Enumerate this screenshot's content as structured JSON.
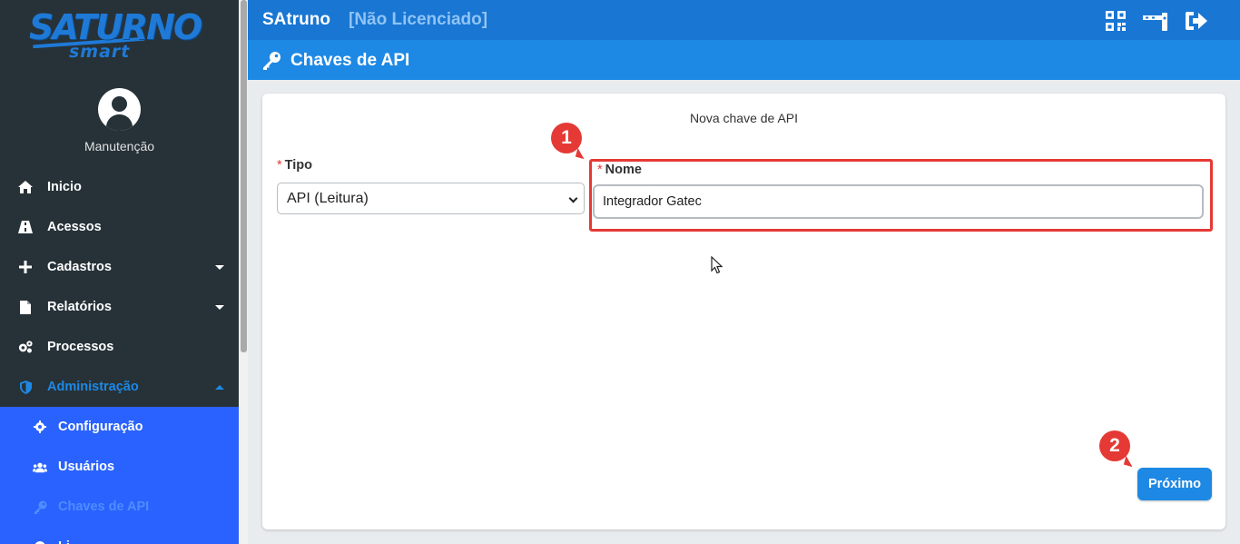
{
  "logo": {
    "line1": "SATURNO",
    "line2": "smart"
  },
  "user": {
    "name": "Manutenção"
  },
  "sidebar": {
    "items": [
      {
        "label": "Inicio",
        "icon": "home-icon"
      },
      {
        "label": "Acessos",
        "icon": "road-icon"
      },
      {
        "label": "Cadastros",
        "icon": "plus-icon"
      },
      {
        "label": "Relatórios",
        "icon": "file-icon"
      },
      {
        "label": "Processos",
        "icon": "cogs-icon"
      },
      {
        "label": "Administração",
        "icon": "shield-icon"
      }
    ],
    "submenu": [
      {
        "label": "Configuração",
        "icon": "gear-icon"
      },
      {
        "label": "Usuários",
        "icon": "users-icon"
      },
      {
        "label": "Chaves de API",
        "icon": "key-icon"
      },
      {
        "label": "Li",
        "icon": "circle-icon"
      }
    ]
  },
  "topbar": {
    "app_title": "SAtruno",
    "license": "[Não Licenciado]",
    "icons": [
      "qr-code-icon",
      "barrier-icon",
      "logout-icon"
    ]
  },
  "page": {
    "title": "Chaves de API"
  },
  "form": {
    "card_title": "Nova chave de API",
    "required_mark": "*",
    "tipo_label": "Tipo",
    "tipo_value": "API (Leitura)",
    "nome_label": "Nome",
    "nome_value": "Integrador Gatec",
    "next_button": "Próximo"
  },
  "annotations": {
    "step1": "1",
    "step2": "2"
  },
  "colors": {
    "sidebar_bg": "#263238",
    "topbar_bg": "#1976d2",
    "pagebar_bg": "#1e88e5",
    "submenu_bg": "#2962ff",
    "accent": "#1e88e5",
    "annotation_red": "#e53935"
  }
}
